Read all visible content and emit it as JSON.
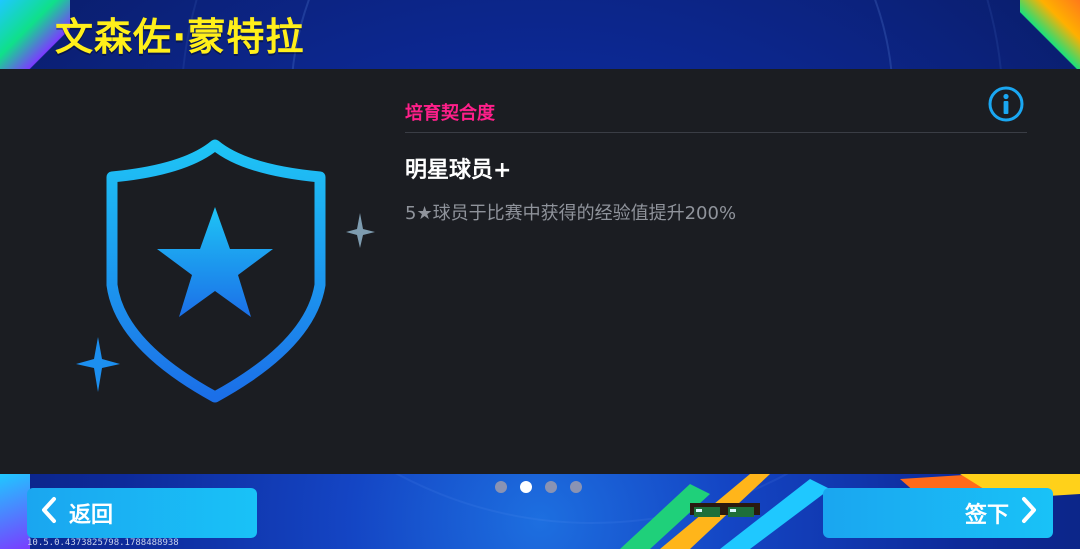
{
  "header": {
    "title": "文森佐·蒙特拉"
  },
  "panel": {
    "section_label": "培育契合度",
    "skill_name": "明星球员+",
    "skill_description": "5★球员于比赛中获得的经验值提升200%",
    "info_icon": "info-icon",
    "badge_icon": "shield-star-icon"
  },
  "pagination": {
    "total": 4,
    "active_index": 1
  },
  "footer": {
    "back_label": "返回",
    "sign_label": "签下",
    "version": "10.5.0.4373825798.1788488938"
  },
  "colors": {
    "title": "#ffef1a",
    "section_label": "#ff1f8a",
    "accent": "#19b0f4",
    "panel_bg": "#1b1d22"
  }
}
